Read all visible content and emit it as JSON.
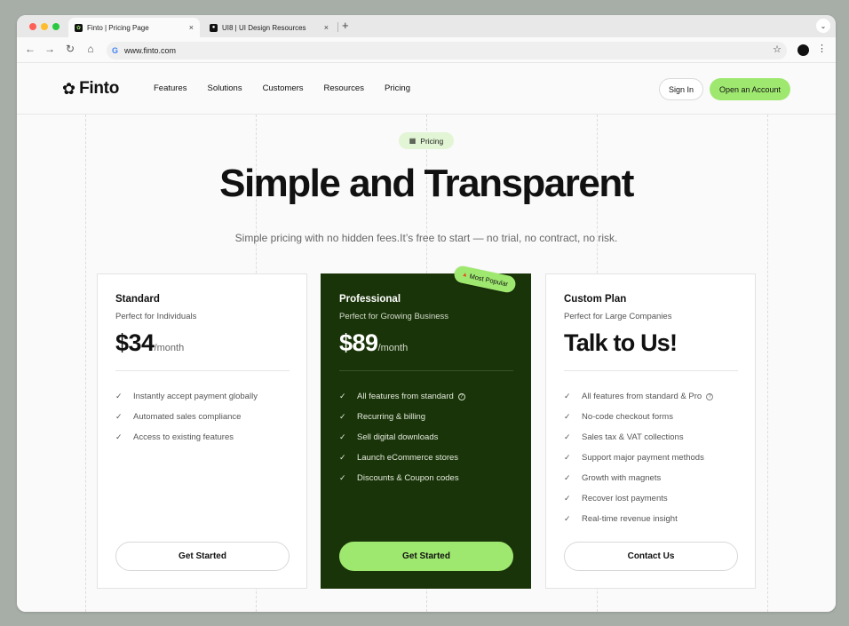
{
  "browser": {
    "tabs": [
      {
        "title": "Finto | Pricing Page",
        "active": true
      },
      {
        "title": "UI8 | UI Design Resources",
        "active": false
      }
    ],
    "close_glyph": "×",
    "new_tab_glyph": "+",
    "url": "www.finto.com"
  },
  "nav": {
    "brand": "Finto",
    "links": [
      "Features",
      "Solutions",
      "Customers",
      "Resources",
      "Pricing"
    ],
    "sign_in": "Sign In",
    "open_account": "Open an Account"
  },
  "hero": {
    "pill": "Pricing",
    "title": "Simple and Transparent",
    "subtitle": "Simple pricing with no hidden fees.It’s free to start — no trial, no contract, no risk."
  },
  "plans": [
    {
      "name": "Standard",
      "tagline": "Perfect for Individuals",
      "price": "$34",
      "period": "/month",
      "features": [
        {
          "text": "Instantly accept payment globally"
        },
        {
          "text": "Automated sales compliance"
        },
        {
          "text": "Access to existing features"
        }
      ],
      "cta": "Get Started"
    },
    {
      "name": "Professional",
      "tagline": "Perfect for Growing Business",
      "price": "$89",
      "period": "/month",
      "badge": "Most Popular",
      "features": [
        {
          "text": "All features from standard",
          "help": "?"
        },
        {
          "text": "Recurring & billing"
        },
        {
          "text": "Sell digital downloads"
        },
        {
          "text": "Launch eCommerce stores"
        },
        {
          "text": "Discounts & Coupon codes"
        }
      ],
      "cta": "Get Started"
    },
    {
      "name": "Custom Plan",
      "tagline": "Perfect for Large Companies",
      "headline": "Talk to Us!",
      "features": [
        {
          "text": "All features from standard & Pro",
          "help": "?"
        },
        {
          "text": "No-code checkout forms"
        },
        {
          "text": "Sales tax & VAT collections"
        },
        {
          "text": "Support major payment methods"
        },
        {
          "text": "Growth with magnets"
        },
        {
          "text": "Recover lost payments"
        },
        {
          "text": "Real-time revenue insight"
        }
      ],
      "cta": "Contact Us"
    }
  ],
  "colors": {
    "accent": "#9fe870",
    "dark_card": "#1a3409",
    "pill_bg": "#e2f5d4"
  }
}
